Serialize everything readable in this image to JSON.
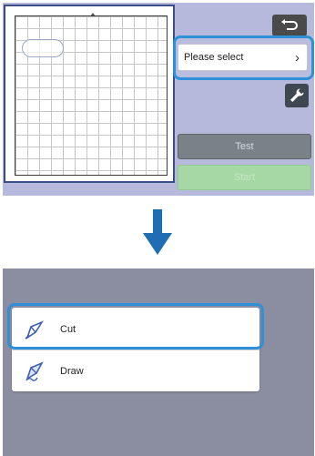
{
  "top_panel": {
    "back_icon": "return-arrow-icon",
    "select_button": {
      "label": "Please select",
      "chevron": "›"
    },
    "settings_icon": "wrench-icon",
    "test_label": "Test",
    "start_label": "Start"
  },
  "menu": {
    "items": [
      {
        "label": "Cut",
        "icon": "cut-tool-icon"
      },
      {
        "label": "Draw",
        "icon": "pen-tool-icon"
      }
    ]
  },
  "colors": {
    "top_bg": "#b7b9dc",
    "bottom_bg": "#8b8da1",
    "highlight": "#2d90d8",
    "arrow": "#1f6db3",
    "start_green": "#a6d8a6"
  }
}
